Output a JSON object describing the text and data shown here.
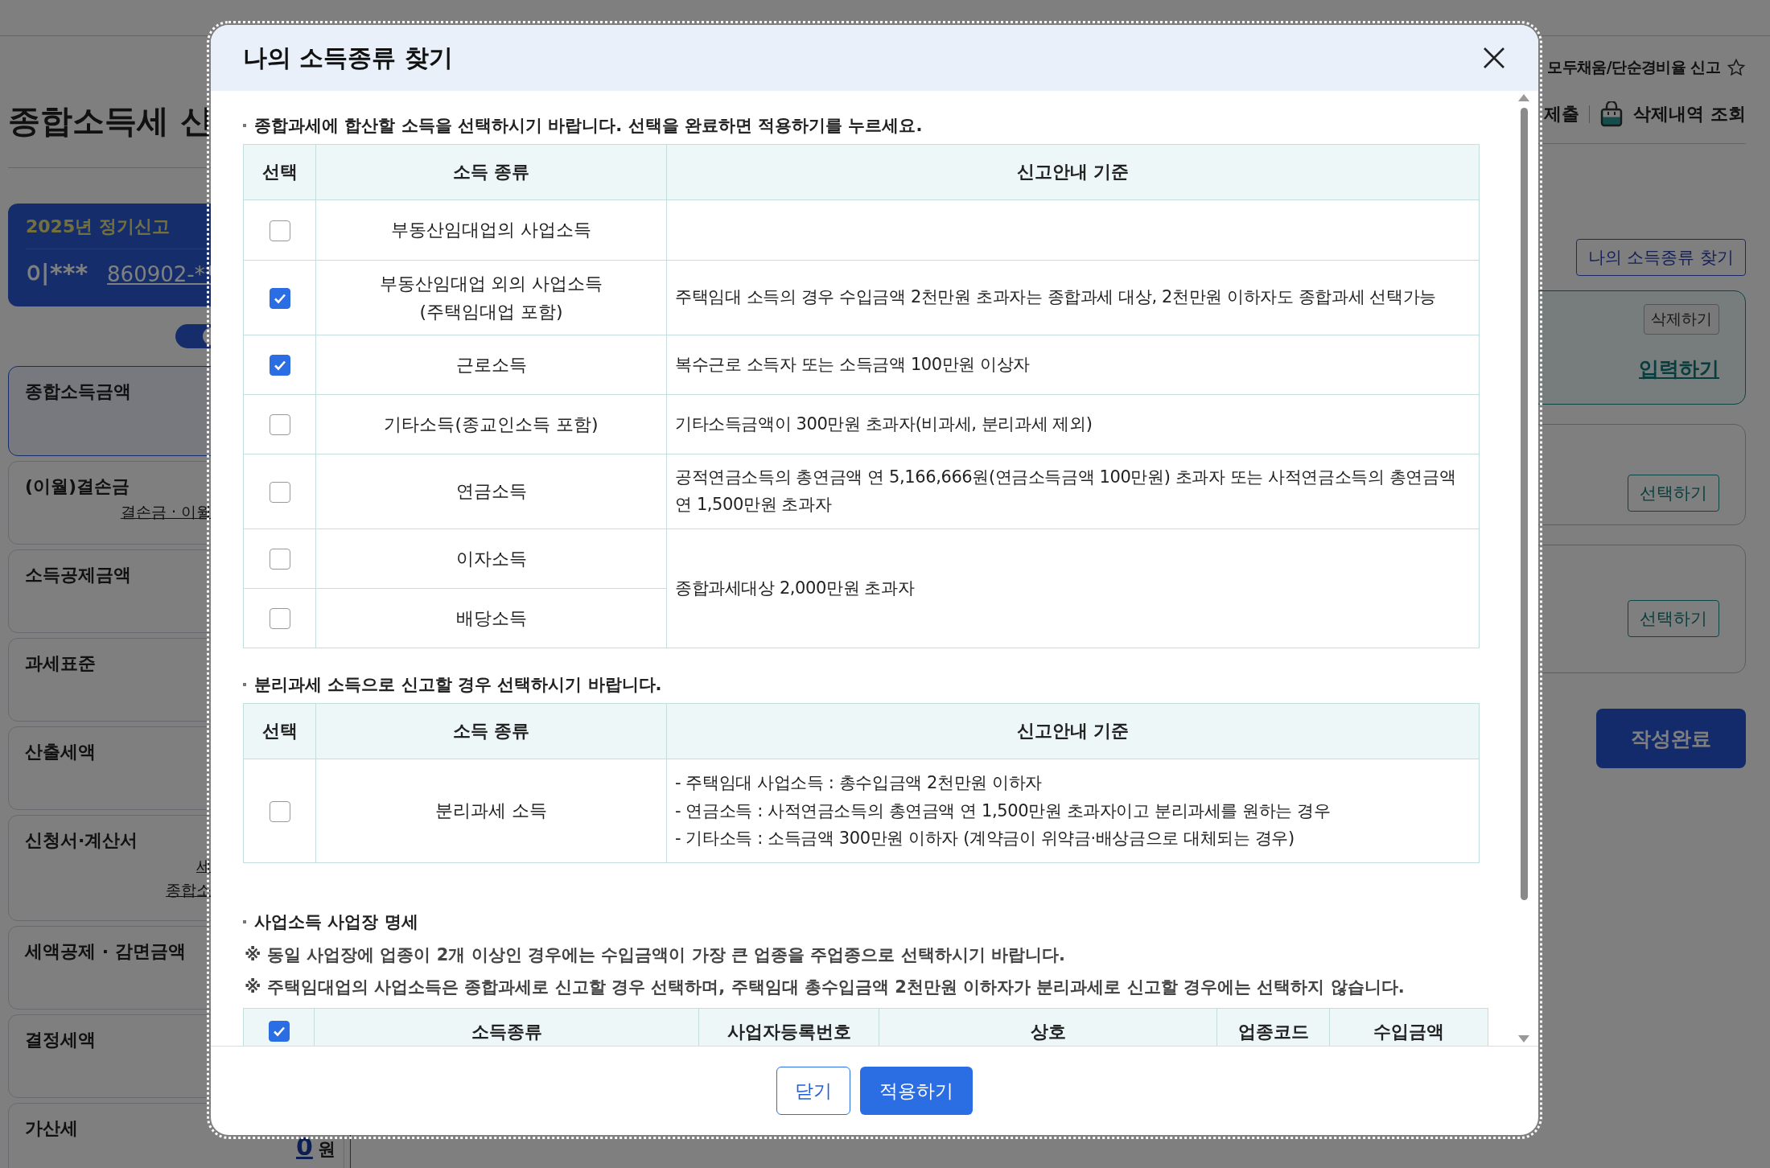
{
  "page": {
    "title": "종합소득세 신",
    "filing_card": {
      "label": "2025년 정기신고",
      "name": "이***",
      "id": "860902-**"
    },
    "toggle": {
      "on": true
    },
    "sidebar": [
      {
        "label": "종합소득금액",
        "selected": true
      },
      {
        "label": "(이월)결손금",
        "selected": false,
        "links": [
          "결손금 · 이월"
        ]
      },
      {
        "label": "소득공제금액",
        "selected": false
      },
      {
        "label": "과세표준",
        "selected": false
      },
      {
        "label": "산출세액",
        "selected": false
      },
      {
        "label": "신청서·계산서",
        "selected": false,
        "links": [
          "세",
          "종합소"
        ]
      },
      {
        "label": "세액공제 · 감면금액",
        "selected": false
      },
      {
        "label": "결정세액",
        "selected": false
      },
      {
        "label": "가산세",
        "selected": false
      }
    ],
    "penalty_value": "0",
    "penalty_unit": "원",
    "top_link": "모두채움/단순경비율 신고",
    "toolbar": {
      "submit": "제출",
      "deleted_history": "삭제내역 조회"
    },
    "find_button": "나의 소득종류 찾기",
    "income_card": {
      "delete_button": "삭제하기",
      "input_link": "입력하기"
    },
    "select_buttons": [
      "선택하기",
      "선택하기"
    ],
    "complete_button": "작성완료"
  },
  "modal": {
    "title": "나의 소득종류 찾기",
    "combined": {
      "note": "종합과세에 합산할 소득을 선택하시기 바랍니다. 선택을 완료하면 적용하기를 누르세요.",
      "columns": [
        "선택",
        "소득 종류",
        "신고안내 기준"
      ],
      "rows": [
        {
          "checked": false,
          "type": "부동산임대업의 사업소득"
        },
        {
          "checked": true,
          "type": "부동산임대업 외의 사업소득\n(주택임대업 포함)",
          "criterion": "주택임대 소득의 경우 수입금액 2천만원 초과자는 종합과세 대상, 2천만원 이하자도 종합과세 선택가능"
        },
        {
          "checked": true,
          "type": "근로소득",
          "criterion": "복수근로 소득자 또는 소득금액 100만원 이상자"
        },
        {
          "checked": false,
          "type": "기타소득(종교인소득 포함)",
          "criterion": "기타소득금액이 300만원 초과자(비과세, 분리과세 제외)"
        },
        {
          "checked": false,
          "type": "연금소득",
          "criterion": "공적연금소득의 총연금액 연 5,166,666원(연금소득금액 100만원) 초과자 또는 사적연금소득의 총연금액 연 1,500만원 초과자"
        },
        {
          "checked": false,
          "type": "이자소득",
          "criterion": "종합과세대상 2,000만원 초과자"
        },
        {
          "checked": false,
          "type": "배당소득",
          "shares_criterion": true
        }
      ]
    },
    "separate": {
      "note": "분리과세 소득으로 신고할 경우 선택하시기 바랍니다.",
      "columns": [
        "선택",
        "소득 종류",
        "신고안내 기준"
      ],
      "rows": [
        {
          "checked": false,
          "type": "분리과세 소득",
          "criteria": [
            "- 주택임대 사업소득 : 총수입금액 2천만원 이하자",
            "- 연금소득 : 사적연금소득의 총연금액 연 1,500만원 초과자이고 분리과세를 원하는 경우",
            "- 기타소득 : 소득금액 300만원 이하자 (계약금이 위약금·배상금으로 대체되는 경우)"
          ]
        }
      ]
    },
    "business": {
      "title": "사업소득 사업장 명세",
      "notes": [
        "※ 동일 사업장에 업종이 2개 이상인 경우에는 수입금액이 가장 큰 업종을 주업종으로 선택하시기 바랍니다.",
        "※ 주택임대업의 사업소득은 종합과세로 신고할 경우 선택하며, 주택임대 총수입금액 2천만원 이하자가 분리과세로 신고할 경우에는 선택하지 않습니다."
      ],
      "all_checked": true,
      "columns": [
        "소득종류",
        "사업자등록번호",
        "상호",
        "업종코드",
        "수입금액"
      ]
    },
    "buttons": [
      {
        "label": "닫기",
        "kind": "secondary"
      },
      {
        "label": "적용하기",
        "kind": "primary"
      }
    ]
  }
}
